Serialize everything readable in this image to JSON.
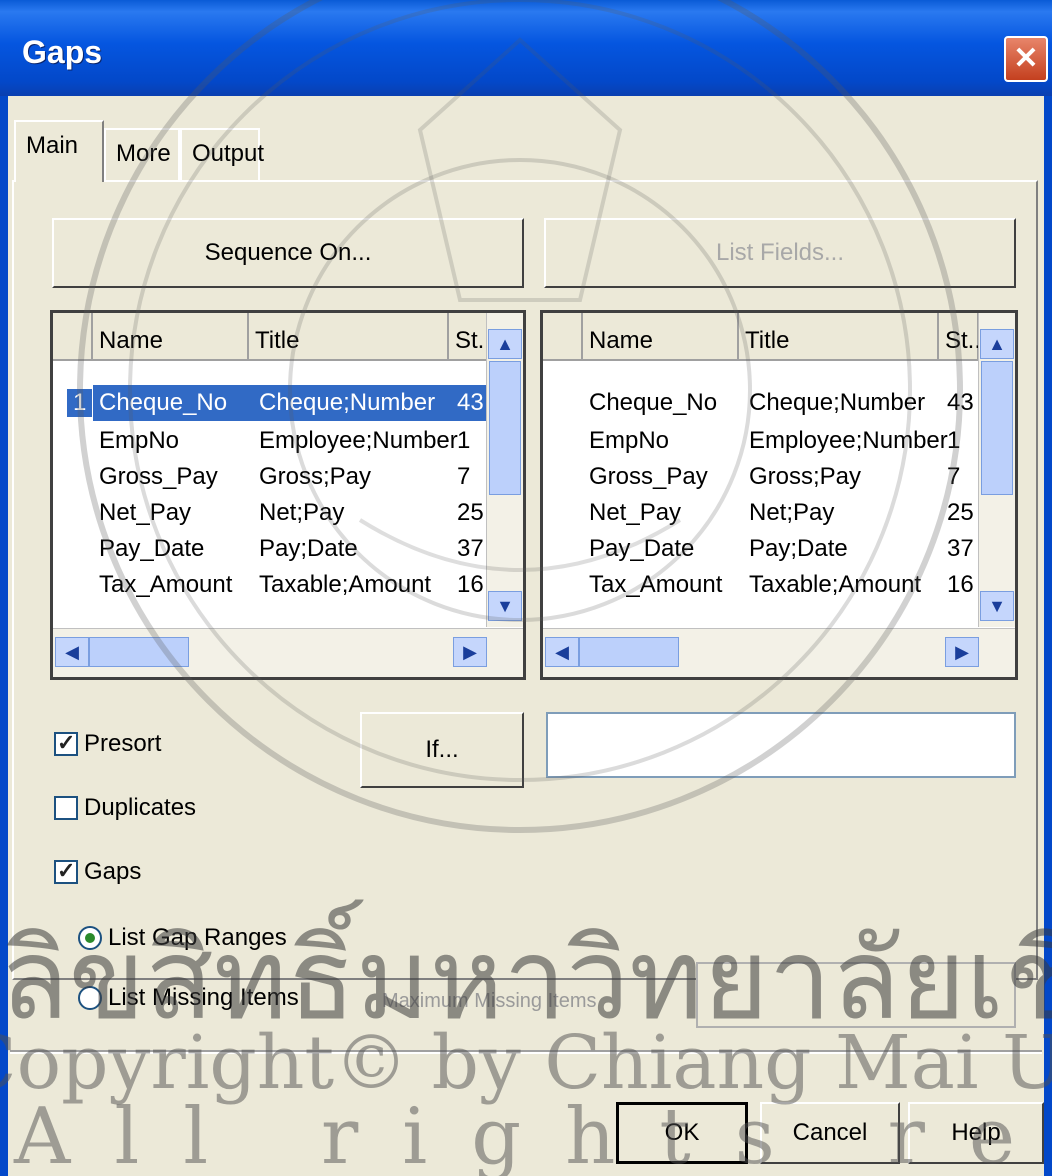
{
  "window": {
    "title": "Gaps",
    "close_icon": "close-icon"
  },
  "tabs": [
    {
      "label": "Main",
      "active": true
    },
    {
      "label": "More",
      "active": false
    },
    {
      "label": "Output",
      "active": false
    }
  ],
  "buttons": {
    "sequence_on": "Sequence On...",
    "list_fields": "List Fields...",
    "if": "If...",
    "ok": "OK",
    "cancel": "Cancel",
    "help": "Help"
  },
  "left_list": {
    "columns": [
      "Name",
      "Title",
      "St.."
    ],
    "selected_row_index": "1",
    "rows": [
      {
        "name": "Cheque_No",
        "title": "Cheque;Number",
        "st": "43"
      },
      {
        "name": "EmpNo",
        "title": "Employee;Number",
        "st": "1"
      },
      {
        "name": "Gross_Pay",
        "title": "Gross;Pay",
        "st": "7"
      },
      {
        "name": "Net_Pay",
        "title": "Net;Pay",
        "st": "25"
      },
      {
        "name": "Pay_Date",
        "title": "Pay;Date",
        "st": "37"
      },
      {
        "name": "Tax_Amount",
        "title": "Taxable;Amount",
        "st": "16"
      }
    ]
  },
  "right_list": {
    "columns": [
      "Name",
      "Title",
      "St.."
    ],
    "rows": [
      {
        "name": "Cheque_No",
        "title": "Cheque;Number",
        "st": "43"
      },
      {
        "name": "EmpNo",
        "title": "Employee;Number",
        "st": "1"
      },
      {
        "name": "Gross_Pay",
        "title": "Gross;Pay",
        "st": "7"
      },
      {
        "name": "Net_Pay",
        "title": "Net;Pay",
        "st": "25"
      },
      {
        "name": "Pay_Date",
        "title": "Pay;Date",
        "st": "37"
      },
      {
        "name": "Tax_Amount",
        "title": "Taxable;Amount",
        "st": "16"
      }
    ]
  },
  "options": {
    "presort": {
      "label": "Presort",
      "checked": true
    },
    "duplicates": {
      "label": "Duplicates",
      "checked": false
    },
    "gaps": {
      "label": "Gaps",
      "checked": true
    },
    "list_gap_ranges": {
      "label": "List Gap Ranges",
      "selected": true
    },
    "list_missing_items": {
      "label": "List Missing Items",
      "selected": false
    },
    "maximum_missing_items_label": "Maximum Missing Items",
    "if_expression": "",
    "maximum_missing_items_value": ""
  },
  "watermark": {
    "thai_text": "ลิขสิทธิ์มหาวิทยาลัยเชียงใหม่",
    "copyright_text": "Copyright© by Chiang Mai University",
    "rights_text": "All rights reserved"
  },
  "colors": {
    "titlebar": "#0348c9",
    "selection": "#316ac5",
    "dialog_bg": "#ece9d8"
  }
}
